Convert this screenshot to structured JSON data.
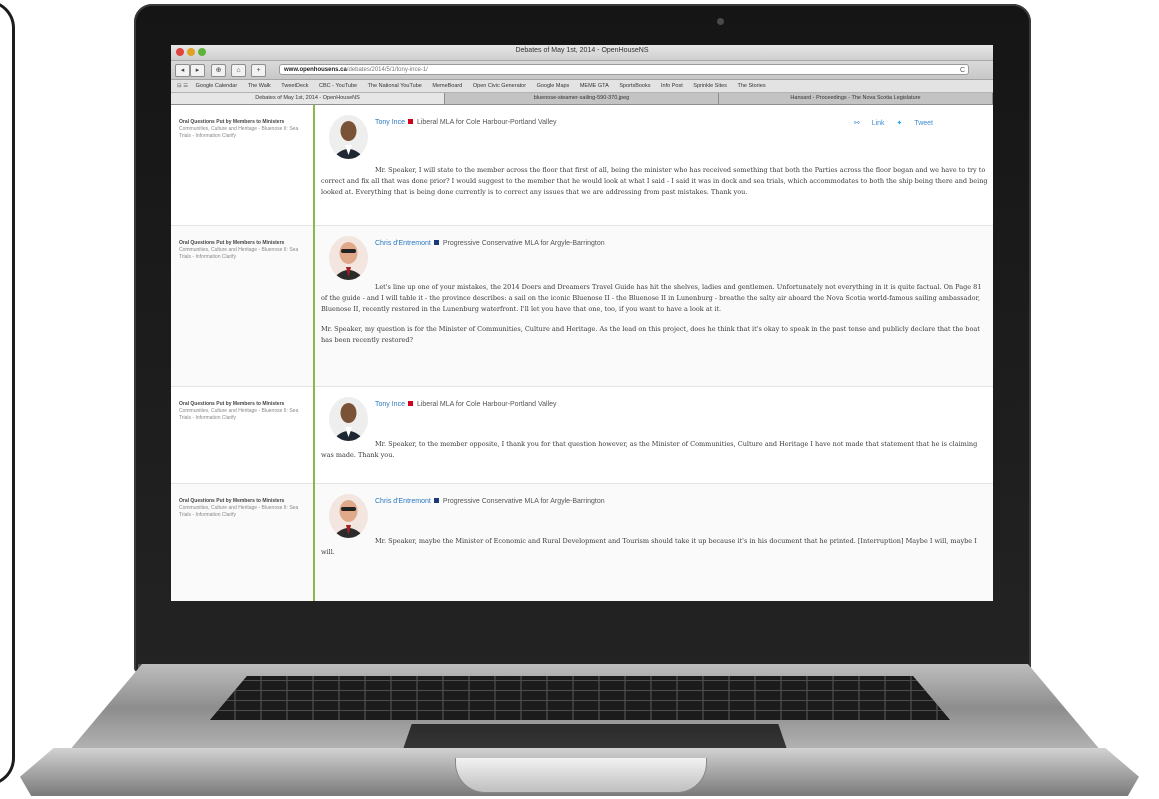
{
  "window": {
    "title": "Debates of May 1st, 2014 - OpenHouseNS"
  },
  "toolbar": {
    "back": "◂",
    "forward": "▸",
    "reader": "⊕",
    "home": "⌂",
    "add": "+",
    "url_domain": "www.openhousens.ca",
    "url_path": "/debates/2014/5/1/tony-ince-1/",
    "reload": "C"
  },
  "bookmarks": {
    "items": [
      "Google Calendar",
      "The Walk",
      "TweetDeck",
      "CBC - YouTube",
      "The National YouTube",
      "MemeBoard",
      "Open Civic Generator",
      "Google Maps",
      "MEME GTA",
      "SportsBooks",
      "Info Post",
      "Sprinkle Sites",
      "The Stories"
    ]
  },
  "tabs": [
    {
      "label": "Debates of May 1st, 2014 - OpenHouseNS",
      "active": true
    },
    {
      "label": "bluenose-steamer-sailing-590-370.jpeg",
      "active": false
    },
    {
      "label": "Hansard - Proceedings - The Nova Scotia Legislature",
      "active": false
    }
  ],
  "share": {
    "link": "Link",
    "tweet": "Tweet"
  },
  "entries": [
    {
      "meta_title": "Oral Questions Put by Members to Ministers",
      "meta_topic": "Communities, Culture and Heritage - Bluenose II: Sea Trials - Information Clarify",
      "speaker": "Tony Ince",
      "party_color": "#d0021b",
      "role": "Liberal MLA for Cole Harbour-Portland Valley",
      "paragraphs": [
        "Mr. Speaker, I will state to the member across the floor that first of all, being the minister who has received something that both the Parties across the floor began and we have to try to correct and fix all that was done prior? I would suggest to the member that he would look at what I said - I said it was in dock and sea trials, which accommodates to both the ship being there and being looked at. Everything that is being done currently is to correct any issues that we are addressing from past mistakes. Thank you."
      ]
    },
    {
      "meta_title": "Oral Questions Put by Members to Ministers",
      "meta_topic": "Communities, Culture and Heritage - Bluenose II: Sea Trials - Information Clarify",
      "speaker": "Chris d'Entremont",
      "party_color": "#1a3a7a",
      "role": "Progressive Conservative MLA for Argyle-Barrington",
      "paragraphs": [
        "Let's line up one of your mistakes, the 2014 Doers and Dreamers Travel Guide has hit the shelves, ladies and gentlemen. Unfortunately not everything in it is quite factual. On Page 81 of the guide - and I will table it - the province describes: a sail on the iconic Bluenose II - the Bluenose II in Lunenburg - breathe the salty air aboard the Nova Scotia world-famous sailing ambassador, Bluenose II, recently restored in the Lunenburg waterfront. I'll let you have that one, too, if you want to have a look at it.",
        "Mr. Speaker, my question is for the Minister of Communities, Culture and Heritage. As the lead on this project, does he think that it's okay to speak in the past tense and publicly declare that the boat has been recently restored?"
      ]
    },
    {
      "meta_title": "Oral Questions Put by Members to Ministers",
      "meta_topic": "Communities, Culture and Heritage - Bluenose II: Sea Trials - Information Clarify",
      "speaker": "Tony Ince",
      "party_color": "#d0021b",
      "role": "Liberal MLA for Cole Harbour-Portland Valley",
      "paragraphs": [
        "Mr. Speaker, to the member opposite, I thank you for that question however, as the Minister of Communities, Culture and Heritage I have not made that statement that he is claiming was made. Thank you."
      ]
    },
    {
      "meta_title": "Oral Questions Put by Members to Ministers",
      "meta_topic": "Communities, Culture and Heritage - Bluenose II: Sea Trials - Information Clarify",
      "speaker": "Chris d'Entremont",
      "party_color": "#1a3a7a",
      "role": "Progressive Conservative MLA for Argyle-Barrington",
      "paragraphs": [
        "Mr. Speaker, maybe the Minister of Economic and Rural Development and Tourism should take it up because it's in his document that he printed. [Interruption] Maybe I will, maybe I will."
      ]
    }
  ],
  "colors": {
    "accent_line": "#8cb84a",
    "link_blue": "#2a78c0"
  }
}
